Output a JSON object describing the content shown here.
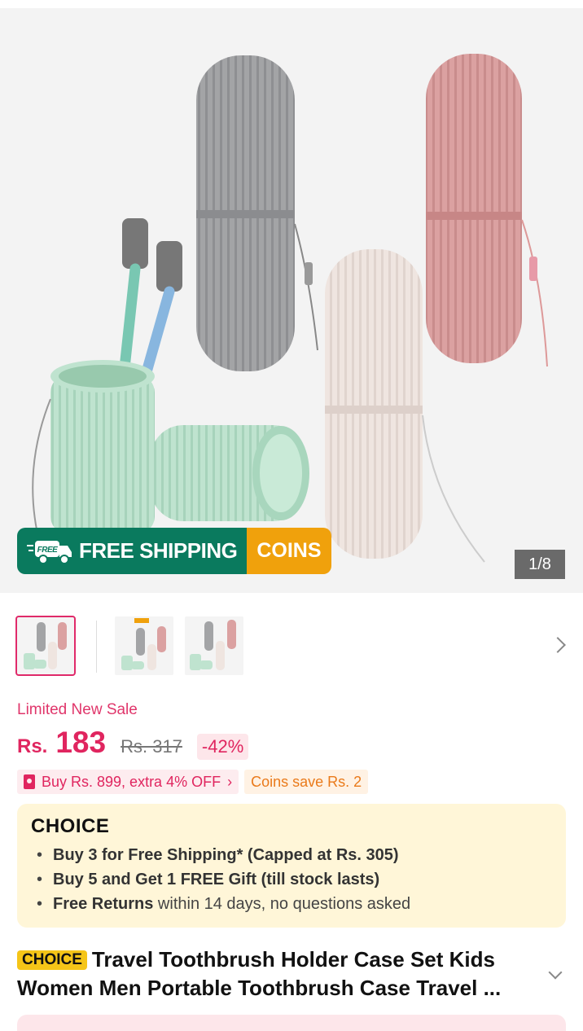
{
  "gallery": {
    "counter": "1/8",
    "banner": {
      "shipping_label": "FREE SHIPPING",
      "coins_label": "COINS",
      "truck_badge": "FREE"
    },
    "colors": {
      "green": "#0a7a5e",
      "orange": "#f0a10c"
    }
  },
  "product": {
    "sale_label": "Limited New Sale",
    "currency": "Rs.",
    "price": "183",
    "old_price": "Rs. 317",
    "discount": "-42%",
    "promos": [
      {
        "label": "Buy Rs. 899, extra 4% OFF",
        "icon": "coupon-icon"
      },
      {
        "label": "Coins save Rs. 2"
      }
    ],
    "choice": {
      "logo": "CHOICE",
      "items": [
        {
          "bold": "Buy 3 for  Free Shipping* (Capped at Rs. 305)",
          "rest": ""
        },
        {
          "bold": "Buy 5 and Get 1 FREE Gift (till stock lasts)",
          "rest": ""
        },
        {
          "bold": "Free Returns",
          "rest": " within 14 days, no questions asked"
        }
      ]
    },
    "title_badge": "CHOICE",
    "title": "Travel Toothbrush Holder Case Set Kids Women Men Portable Toothbrush Case Travel ..."
  },
  "theme": {
    "accent": "#e0255f",
    "choice_bg": "#fff6d8"
  }
}
